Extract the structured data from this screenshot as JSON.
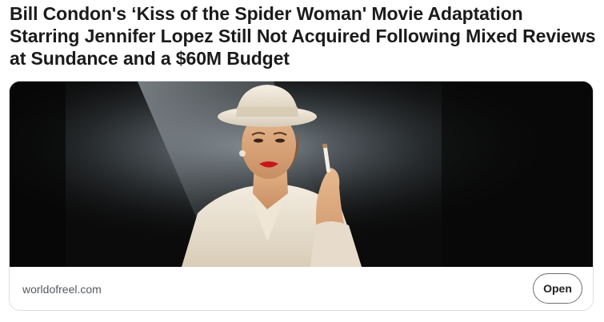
{
  "post": {
    "headline": "Bill Condon's ‘Kiss of the Spider Woman' Movie Adaptation Starring Jennifer Lopez Still Not Acquired Following Mixed Reviews at Sundance and a $60M Budget"
  },
  "link_card": {
    "image_icon": "woman-in-white-fedora-photo",
    "source": "worldofreel.com",
    "open_label": "Open"
  }
}
